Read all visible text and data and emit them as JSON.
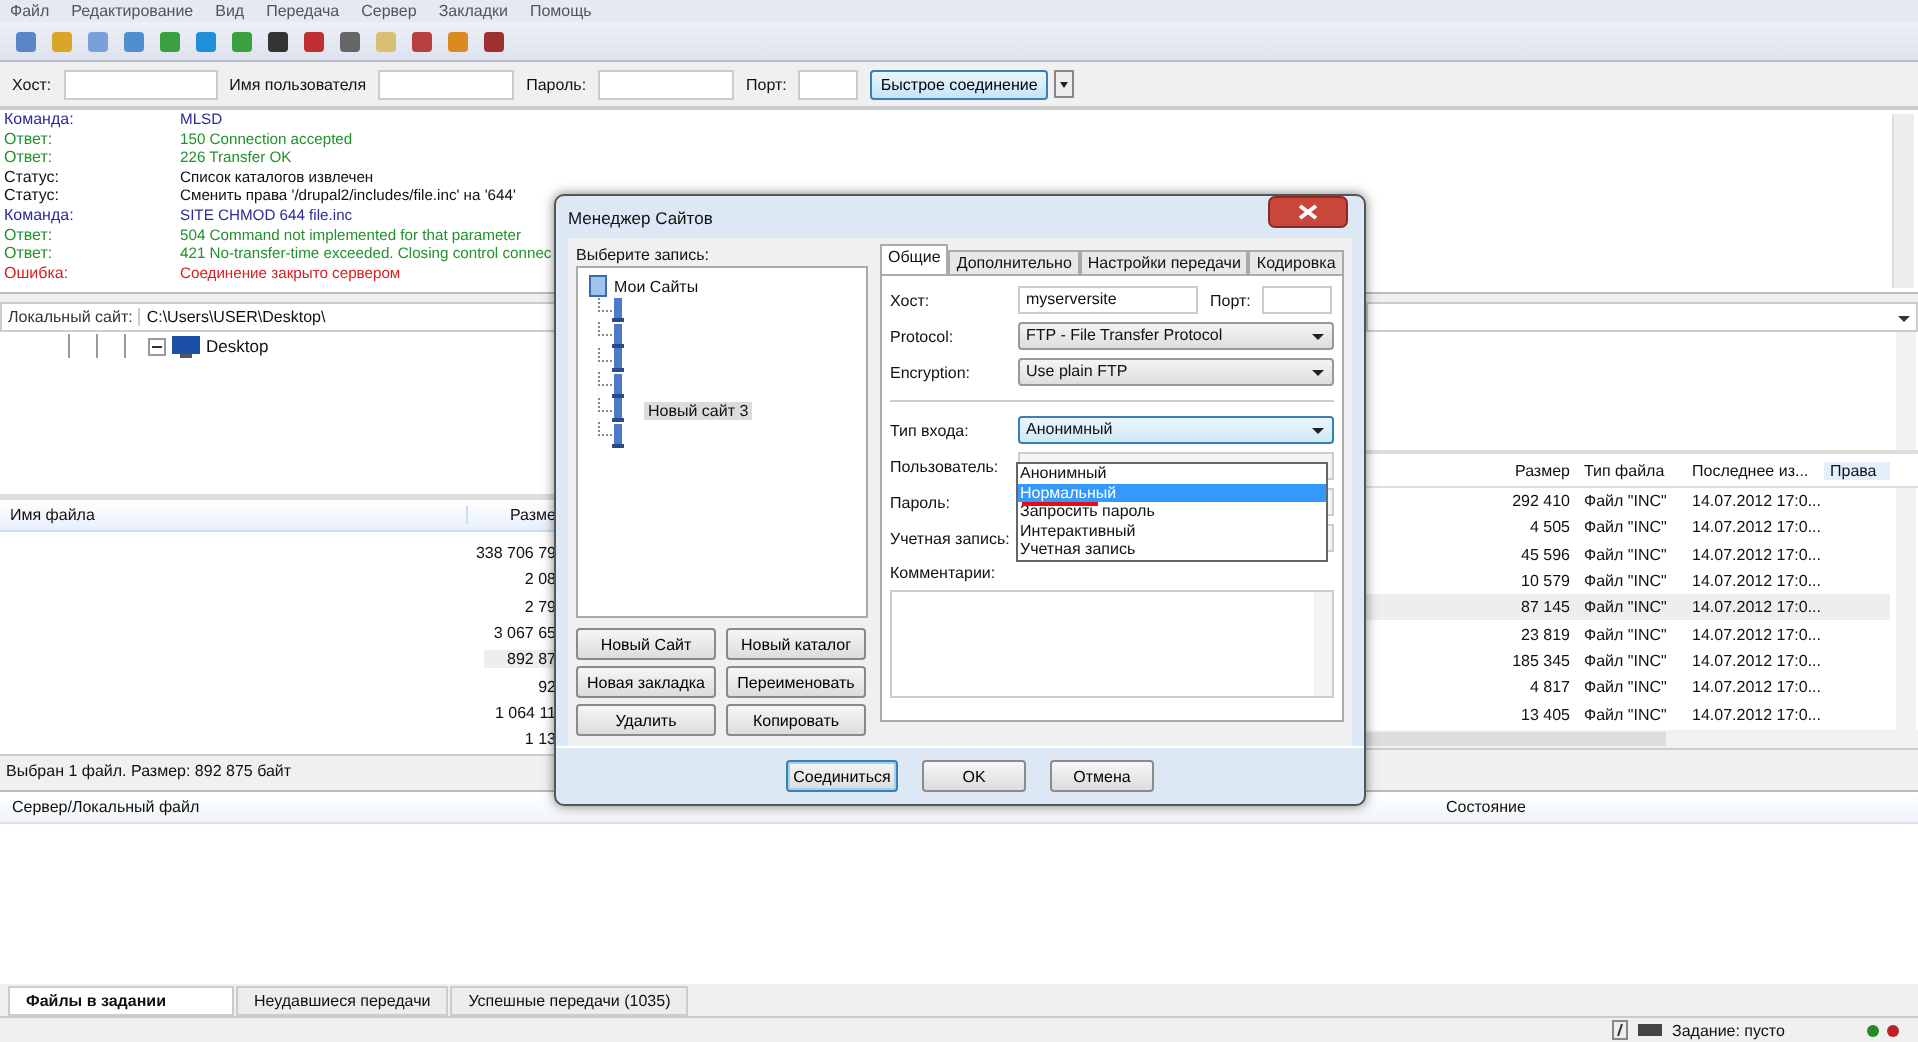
{
  "menu": [
    "Файл",
    "Редактирование",
    "Вид",
    "Передача",
    "Сервер",
    "Закладки",
    "Помощь"
  ],
  "quickconnect": {
    "fields": [
      {
        "label": "Хост:"
      },
      {
        "label": "Имя пользователя"
      },
      {
        "label": "Пароль:"
      },
      {
        "label": "Порт:"
      }
    ],
    "button": "Быстрое соединение"
  },
  "log": [
    {
      "kind": "command",
      "label": "Команда:",
      "message": "MLSD"
    },
    {
      "kind": "response",
      "label": "Ответ:",
      "message": "150 Connection accepted"
    },
    {
      "kind": "response",
      "label": "Ответ:",
      "message": "226 Transfer OK"
    },
    {
      "kind": "status",
      "label": "Статус:",
      "message": "Список каталогов извлечен"
    },
    {
      "kind": "status",
      "label": "Статус:",
      "message": "Сменить права '/drupal2/includes/file.inc' на '644'"
    },
    {
      "kind": "command",
      "label": "Команда:",
      "message": "SITE CHMOD 644 file.inc"
    },
    {
      "kind": "response",
      "label": "Ответ:",
      "message": "504 Command not implemented for that parameter"
    },
    {
      "kind": "response",
      "label": "Ответ:",
      "message": "421 No-transfer-time exceeded. Closing control connec"
    },
    {
      "kind": "error",
      "label": "Ошибка:",
      "message": "Соединение закрыто сервером"
    }
  ],
  "local": {
    "site_label": "Локальный сайт:",
    "path": "C:\\Users\\USER\\Desktop\\",
    "tree": [
      {
        "label": "Desktop",
        "expanded": true
      }
    ],
    "columns": [
      "Имя файла",
      "Разме"
    ],
    "rows": [
      {
        "size": "338 706 79",
        "selected": false
      },
      {
        "size": "2 08",
        "selected": false
      },
      {
        "size": "2 79",
        "selected": false
      },
      {
        "size": "3 067 65",
        "selected": false
      },
      {
        "size": "892 87",
        "selected": true
      },
      {
        "size": "92",
        "selected": false
      },
      {
        "size": "1 064 11",
        "selected": false
      },
      {
        "size": "1 13",
        "selected": false
      }
    ],
    "status": "Выбран 1 файл. Размер: 892 875 байт"
  },
  "remote": {
    "columns": [
      "Размер",
      "Тип файла",
      "Последнее из...",
      "Права"
    ],
    "rows": [
      {
        "size": "292 410",
        "type": "Файл \"INC\"",
        "modified": "14.07.2012 17:0...",
        "selected": false
      },
      {
        "size": "4 505",
        "type": "Файл \"INC\"",
        "modified": "14.07.2012 17:0...",
        "selected": false
      },
      {
        "size": "45 596",
        "type": "Файл \"INC\"",
        "modified": "14.07.2012 17:0...",
        "selected": false
      },
      {
        "size": "10 579",
        "type": "Файл \"INC\"",
        "modified": "14.07.2012 17:0...",
        "selected": false
      },
      {
        "size": "87 145",
        "type": "Файл \"INC\"",
        "modified": "14.07.2012 17:0...",
        "selected": true
      },
      {
        "size": "23 819",
        "type": "Файл \"INC\"",
        "modified": "14.07.2012 17:0...",
        "selected": false
      },
      {
        "size": "185 345",
        "type": "Файл \"INC\"",
        "modified": "14.07.2012 17:0...",
        "selected": false
      },
      {
        "size": "4 817",
        "type": "Файл \"INC\"",
        "modified": "14.07.2012 17:0...",
        "selected": false
      },
      {
        "size": "13 405",
        "type": "Файл \"INC\"",
        "modified": "14.07.2012 17:0...",
        "selected": false
      }
    ]
  },
  "queue": {
    "columns": [
      "Сервер/Локальный файл",
      "Состояние"
    ],
    "tabs": [
      {
        "label": "Файлы в задании",
        "selected": true
      },
      {
        "label": "Неудавшиеся передачи",
        "selected": false
      },
      {
        "label": "Успешные передачи (1035)",
        "selected": false
      }
    ]
  },
  "status_bar": {
    "text": "Задание: пусто"
  },
  "dialog": {
    "title": "Менеджер Сайтов",
    "tree_label": "Выберите запись:",
    "tree": {
      "label": "Мои Сайты",
      "children": [
        {
          "kind": "site"
        },
        {
          "kind": "site"
        },
        {
          "kind": "site"
        },
        {
          "kind": "site"
        },
        {
          "kind": "site",
          "label": "Новый сайт 3",
          "selected": true
        },
        {
          "kind": "site"
        }
      ]
    },
    "buttons": [
      "Новый Сайт",
      "Новый каталог",
      "Новая закладка",
      "Переименовать",
      "Удалить",
      "Копировать"
    ],
    "tabs": [
      {
        "label": "Общие",
        "selected": true
      },
      {
        "label": "Дополнительно",
        "selected": false
      },
      {
        "label": "Настройки передачи",
        "selected": false
      },
      {
        "label": "Кодировка",
        "selected": false
      }
    ],
    "host": {
      "label": "Хост:",
      "value": "myserversite"
    },
    "port": {
      "label": "Порт:"
    },
    "protocol": {
      "label": "Protocol:",
      "value": "FTP - File Transfer Protocol"
    },
    "encryption": {
      "label": "Encryption:",
      "value": "Use plain FTP"
    },
    "logon_type": {
      "label": "Тип входа:",
      "value": "Анонимный",
      "expanded": true,
      "options": [
        {
          "label": "Анонимный",
          "highlighted": false,
          "marked": false
        },
        {
          "label": "Нормальный",
          "highlighted": true,
          "marked": true
        },
        {
          "label": "Запросить пароль",
          "highlighted": false,
          "marked": false
        },
        {
          "label": "Интерактивный",
          "highlighted": false,
          "marked": false
        },
        {
          "label": "Учетная запись",
          "highlighted": false,
          "marked": false
        }
      ]
    },
    "user": {
      "label": "Пользователь:"
    },
    "password": {
      "label": "Пароль:"
    },
    "account": {
      "label": "Учетная запись:"
    },
    "comments": {
      "label": "Комментарии:"
    },
    "footer_buttons": [
      {
        "label": "Соединиться",
        "default": true
      },
      {
        "label": "OK",
        "default": false
      },
      {
        "label": "Отмена",
        "default": false
      }
    ]
  }
}
